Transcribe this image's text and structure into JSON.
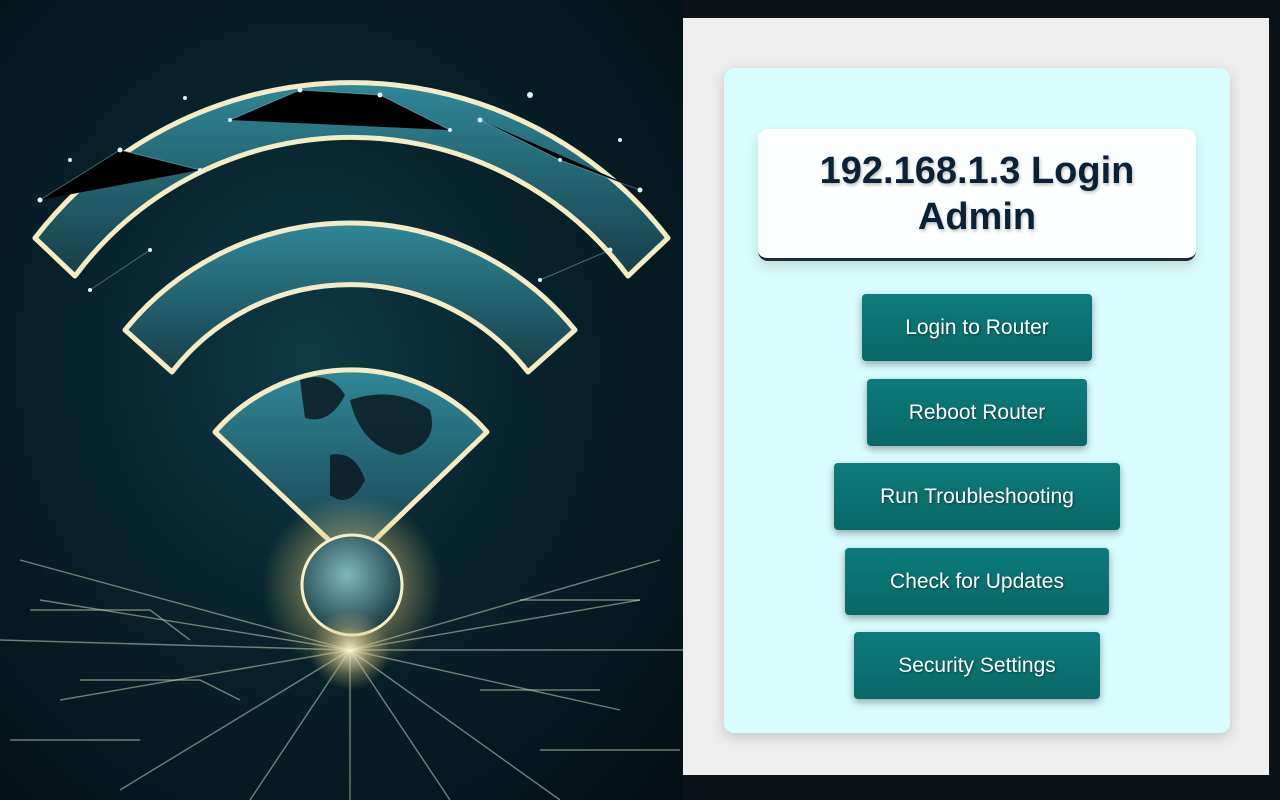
{
  "page": {
    "title": "192.168.1.3 Login Admin"
  },
  "hero": {
    "image": "wifi-globe-illustration"
  },
  "menu": {
    "login": "Login to Router",
    "reboot": "Reboot Router",
    "troubleshoot": "Run Troubleshooting",
    "updates": "Check for Updates",
    "security": "Security Settings"
  },
  "colors": {
    "card_background": "#d9fcfd",
    "button_background": "#0a6f6d",
    "title_text": "#0b2236"
  }
}
